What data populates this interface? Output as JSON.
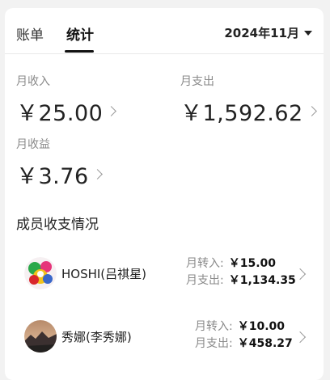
{
  "tabs": {
    "ledger": "账单",
    "stats": "统计"
  },
  "month_selector": {
    "label": "2024年11月"
  },
  "stats": {
    "income": {
      "label": "月收入",
      "amount": "￥25.00"
    },
    "expense": {
      "label": "月支出",
      "amount": "￥1,592.62"
    },
    "yield": {
      "label": "月收益",
      "amount": "￥3.76"
    }
  },
  "members_section": {
    "title": "成员收支情况"
  },
  "members": [
    {
      "name": "HOSHI(吕祺星)",
      "transfer_in_label": "月转入:",
      "transfer_in": "￥15.00",
      "expense_label": "月支出:",
      "expense": "￥1,134.35",
      "avatar_icon": "colorful-sticker-avatar-icon"
    },
    {
      "name": "秀娜(李秀娜)",
      "transfer_in_label": "月转入:",
      "transfer_in": "￥10.00",
      "expense_label": "月支出:",
      "expense": "￥458.27",
      "avatar_icon": "landscape-photo-avatar-icon"
    }
  ]
}
